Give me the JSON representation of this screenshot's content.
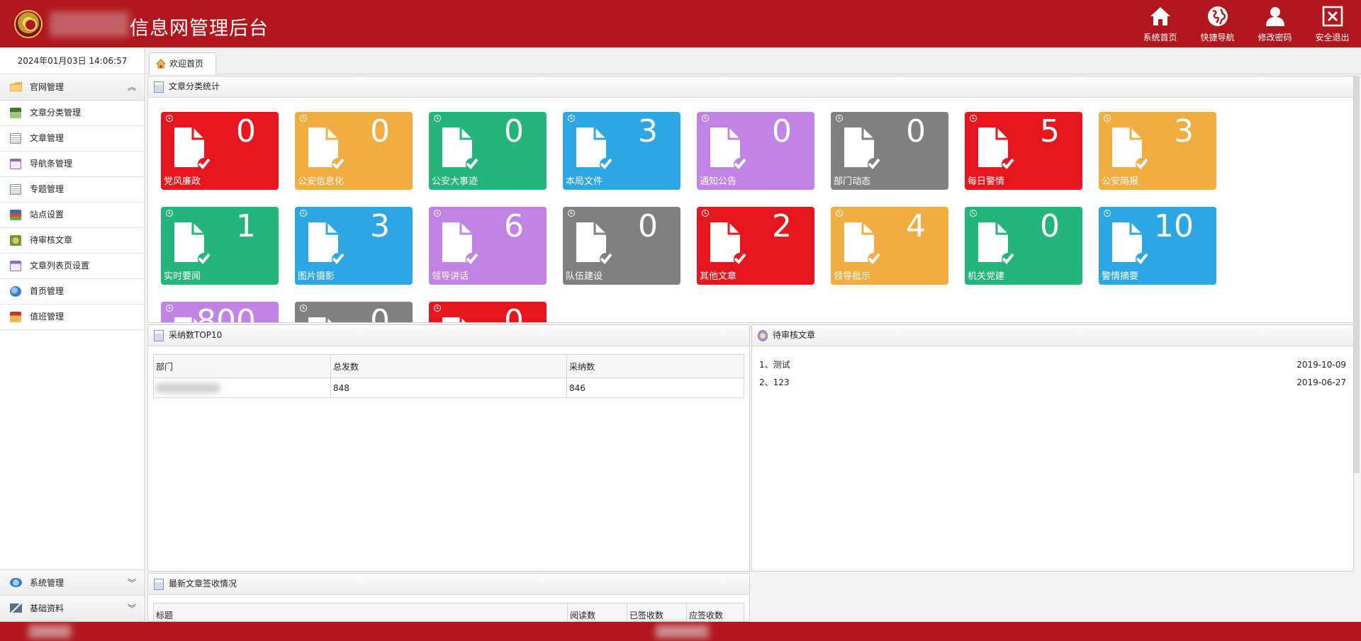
{
  "header": {
    "title": "信息网管理后台",
    "nav": [
      {
        "label": "系统首页",
        "icon": "home-icon"
      },
      {
        "label": "快捷导航",
        "icon": "globe-icon"
      },
      {
        "label": "修改密码",
        "icon": "user-icon"
      },
      {
        "label": "安全退出",
        "icon": "close-box-icon"
      }
    ]
  },
  "sidebar": {
    "datetime": "2024年01月03日 14:06:57",
    "group_main": "官网管理",
    "items": [
      {
        "label": "文章分类管理",
        "icon": "category-icon",
        "color": "#4c8a3a"
      },
      {
        "label": "文章管理",
        "icon": "list-icon",
        "color": "#7b8aa0"
      },
      {
        "label": "导航条管理",
        "icon": "window-icon",
        "color": "#8d6fb8"
      },
      {
        "label": "专题管理",
        "icon": "list-icon",
        "color": "#7b8aa0"
      },
      {
        "label": "站点设置",
        "icon": "books-icon",
        "color": "#3c6ea8"
      },
      {
        "label": "待审核文章",
        "icon": "review-icon",
        "color": "#6a9a3a"
      },
      {
        "label": "文章列表页设置",
        "icon": "window-icon",
        "color": "#8d6fb8"
      },
      {
        "label": "首页管理",
        "icon": "globe-gear-icon",
        "color": "#3a7ec6"
      },
      {
        "label": "值班管理",
        "icon": "house-icon",
        "color": "#d0932a"
      }
    ],
    "group_system": "系统管理",
    "group_basic": "基础资料"
  },
  "tabs": [
    {
      "label": "欢迎首页"
    }
  ],
  "stats_panel": {
    "title": "文章分类统计",
    "cards": [
      {
        "name": "党风廉政",
        "count": "0",
        "color": "red"
      },
      {
        "name": "公安信息化",
        "count": "0",
        "color": "orange"
      },
      {
        "name": "公安大事迹",
        "count": "0",
        "color": "green"
      },
      {
        "name": "本局文件",
        "count": "3",
        "color": "blue"
      },
      {
        "name": "通知公告",
        "count": "0",
        "color": "purple"
      },
      {
        "name": "部门动态",
        "count": "0",
        "color": "gray"
      },
      {
        "name": "每日警情",
        "count": "5",
        "color": "red"
      },
      {
        "name": "公安简报",
        "count": "3",
        "color": "orange"
      },
      {
        "name": "实时要闻",
        "count": "1",
        "color": "green"
      },
      {
        "name": "图片摄影",
        "count": "3",
        "color": "blue"
      },
      {
        "name": "领导讲话",
        "count": "6",
        "color": "purple"
      },
      {
        "name": "队伍建设",
        "count": "0",
        "color": "gray"
      },
      {
        "name": "其他文章",
        "count": "2",
        "color": "red"
      },
      {
        "name": "领导批示",
        "count": "4",
        "color": "orange"
      },
      {
        "name": "机关党建",
        "count": "0",
        "color": "green"
      },
      {
        "name": "警情摘要",
        "count": "10",
        "color": "blue"
      },
      {
        "name": "",
        "count": "800",
        "color": "purple"
      },
      {
        "name": "",
        "count": "0",
        "color": "gray"
      },
      {
        "name": "",
        "count": "0",
        "color": "red"
      }
    ]
  },
  "top10_panel": {
    "title": "采纳数TOP10",
    "columns": [
      "部门",
      "总发数",
      "采纳数"
    ],
    "rows": [
      {
        "dept": "",
        "total": "848",
        "adopted": "846"
      }
    ]
  },
  "pending_panel": {
    "title": "待审核文章",
    "rows": [
      {
        "title": "1、测试",
        "date": "2019-10-09"
      },
      {
        "title": "2、123",
        "date": "2019-06-27"
      }
    ]
  },
  "latest_panel": {
    "title": "最新文章签收情况",
    "columns": [
      "标题",
      "阅读数",
      "已签收数",
      "应签收数"
    ]
  },
  "colors": {
    "header_bg": "#b0161c",
    "red": "#e6161e",
    "orange": "#efad42",
    "green": "#23b57a",
    "blue": "#2ca7e4",
    "purple": "#c184e6",
    "gray": "#808080"
  }
}
